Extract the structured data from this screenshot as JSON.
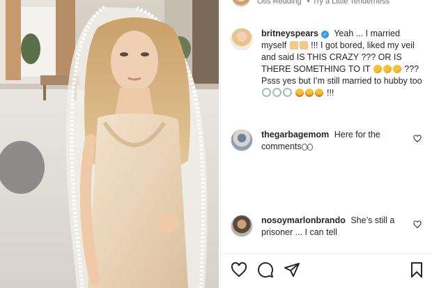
{
  "post": {
    "music": {
      "artist": "Otis Redding",
      "separator": "•",
      "song": "Try a Little Tenderness"
    },
    "caption": {
      "username": "britneyspears",
      "verified": true,
      "text_part1": "Yeah ... I married myself",
      "text_part2": "!!! I got bored, liked my veil and said IS THIS CRAZY ??? OR IS THERE SOMETHING TO IT",
      "text_part3": "??? Psss yes but I’m still married to hubby too",
      "text_part4": "!!!"
    },
    "comments": [
      {
        "username": "thegarbagemom",
        "text": "Here for the comments"
      },
      {
        "username": "nosoymarlonbrando",
        "text": "She’s still a prisoner ... I can tell"
      }
    ]
  },
  "icons": {
    "like": "heart-icon",
    "comment": "comment-icon",
    "share": "send-icon",
    "save": "bookmark-icon",
    "comment_like": "heart-icon"
  },
  "colors": {
    "text": "#262626",
    "muted": "#737373",
    "verified": "#3897f0",
    "divider": "#efefef"
  }
}
